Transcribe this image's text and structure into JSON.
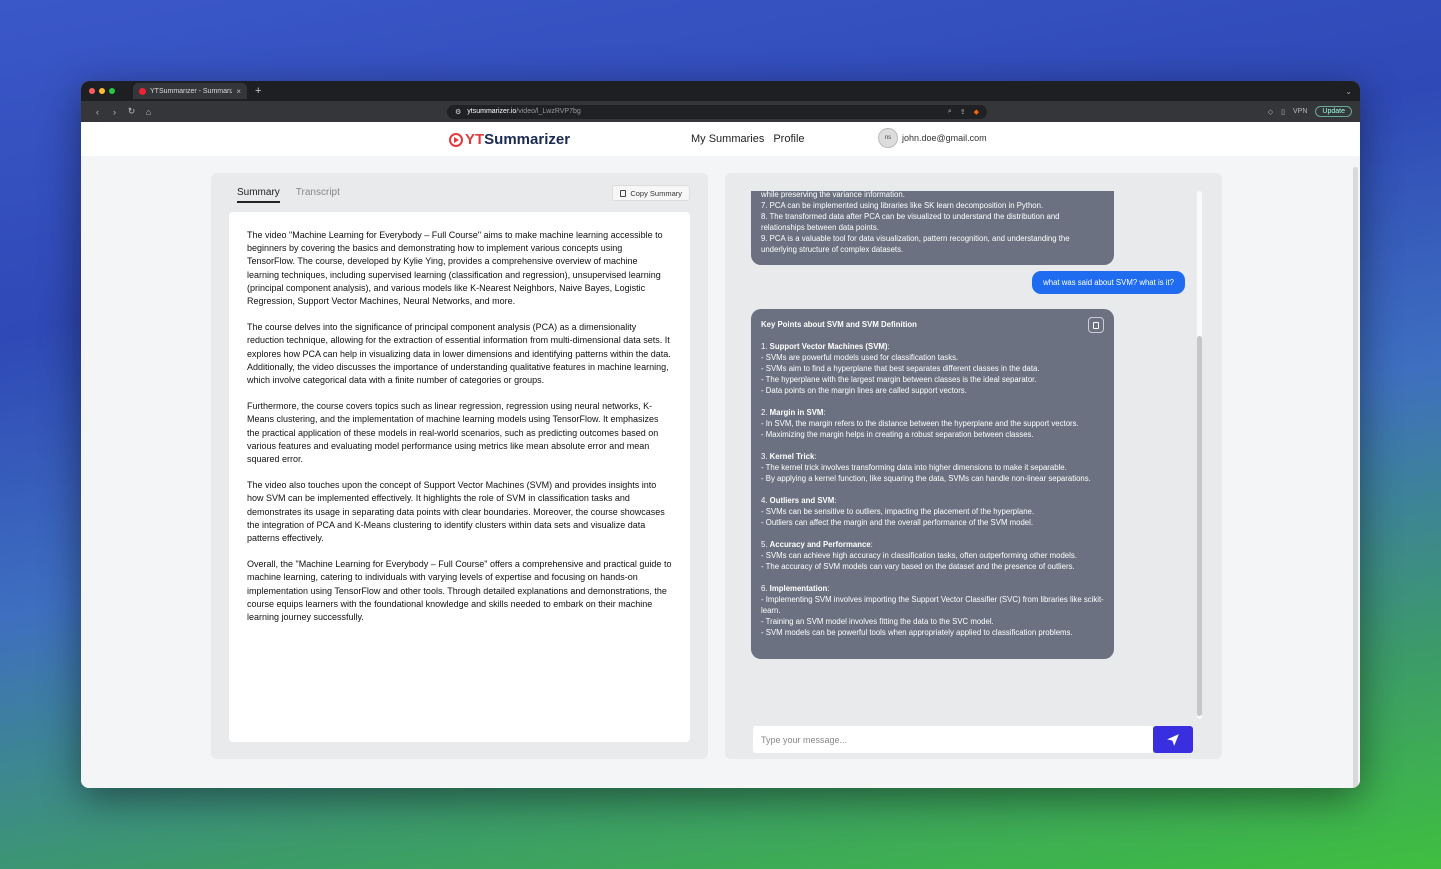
{
  "browser": {
    "tab_title": "YTSummarizer - Summarize",
    "url_host": "ytsummarizer.io",
    "url_path": "/video/l_LwzRVP7bg",
    "vpn_label": "VPN",
    "update_label": "Update"
  },
  "header": {
    "logo_yt": "YT",
    "logo_rest": "Summarizer",
    "nav": [
      "My Summaries",
      "Profile"
    ],
    "avatar_initials": "ns",
    "email": "john.doe@gmail.com"
  },
  "summary_panel": {
    "tabs": [
      "Summary",
      "Transcript"
    ],
    "copy_label": "Copy Summary",
    "paragraphs": [
      "The video \"Machine Learning for Everybody – Full Course\" aims to make machine learning accessible to beginners by covering the basics and demonstrating how to implement various concepts using TensorFlow. The course, developed by Kylie Ying, provides a comprehensive overview of machine learning techniques, including supervised learning (classification and regression), unsupervised learning (principal component analysis), and various models like K-Nearest Neighbors, Naive Bayes, Logistic Regression, Support Vector Machines, Neural Networks, and more.",
      "The course delves into the significance of principal component analysis (PCA) as a dimensionality reduction technique, allowing for the extraction of essential information from multi-dimensional data sets. It explores how PCA can help in visualizing data in lower dimensions and identifying patterns within the data. Additionally, the video discusses the importance of understanding qualitative features in machine learning, which involve categorical data with a finite number of categories or groups.",
      "Furthermore, the course covers topics such as linear regression, regression using neural networks, K-Means clustering, and the implementation of machine learning models using TensorFlow. It emphasizes the practical application of these models in real-world scenarios, such as predicting outcomes based on various features and evaluating model performance using metrics like mean absolute error and mean squared error.",
      "The video also touches upon the concept of Support Vector Machines (SVM) and provides insights into how SVM can be implemented effectively. It highlights the role of SVM in classification tasks and demonstrates its usage in separating data points with clear boundaries. Moreover, the course showcases the integration of PCA and K-Means clustering to identify clusters within data sets and visualize data patterns effectively.",
      "Overall, the \"Machine Learning for Everybody – Full Course\" offers a comprehensive and practical guide to machine learning, catering to individuals with varying levels of expertise and focusing on hands-on implementation using TensorFlow and other tools. Through detailed explanations and demonstrations, the course equips learners with the foundational knowledge and skills needed to embark on their machine learning journey successfully."
    ]
  },
  "chat": {
    "prev_bubble_lines": [
      "while preserving the variance information.",
      "7. PCA can be implemented using libraries like SK learn decomposition in Python.",
      "8. The transformed data after PCA can be visualized to understand the distribution and relationships between data points.",
      "9. PCA is a valuable tool for data visualization, pattern recognition, and understanding the underlying structure of complex datasets."
    ],
    "user_message": "what was said about SVM? what is it?",
    "answer_heading": "Key Points about SVM and SVM Definition",
    "sections": [
      {
        "num": "1. ",
        "title": "Support Vector Machines (SVM)",
        "lines": [
          "- SVMs are powerful models used for classification tasks.",
          "- SVMs aim to find a hyperplane that best separates different classes in the data.",
          "- The hyperplane with the largest margin between classes is the ideal separator.",
          "- Data points on the margin lines are called support vectors."
        ]
      },
      {
        "num": "2. ",
        "title": "Margin in SVM",
        "lines": [
          "- In SVM, the margin refers to the distance between the hyperplane and the support vectors.",
          "- Maximizing the margin helps in creating a robust separation between classes."
        ]
      },
      {
        "num": "3. ",
        "title": "Kernel Trick",
        "lines": [
          "- The kernel trick involves transforming data into higher dimensions to make it separable.",
          "- By applying a kernel function, like squaring the data, SVMs can handle non-linear separations."
        ]
      },
      {
        "num": "4. ",
        "title": "Outliers and SVM",
        "lines": [
          "- SVMs can be sensitive to outliers, impacting the placement of the hyperplane.",
          "- Outliers can affect the margin and the overall performance of the SVM model."
        ]
      },
      {
        "num": "5. ",
        "title": "Accuracy and Performance",
        "lines": [
          "- SVMs can achieve high accuracy in classification tasks, often outperforming other models.",
          "- The accuracy of SVM models can vary based on the dataset and the presence of outliers."
        ]
      },
      {
        "num": "6. ",
        "title": "Implementation",
        "lines": [
          "- Implementing SVM involves importing the Support Vector Classifier (SVC) from libraries like scikit-learn.",
          "- Training an SVM model involves fitting the data to the SVC model.",
          "- SVM models can be powerful tools when appropriately applied to classification problems."
        ]
      }
    ],
    "input_placeholder": "Type your message..."
  }
}
